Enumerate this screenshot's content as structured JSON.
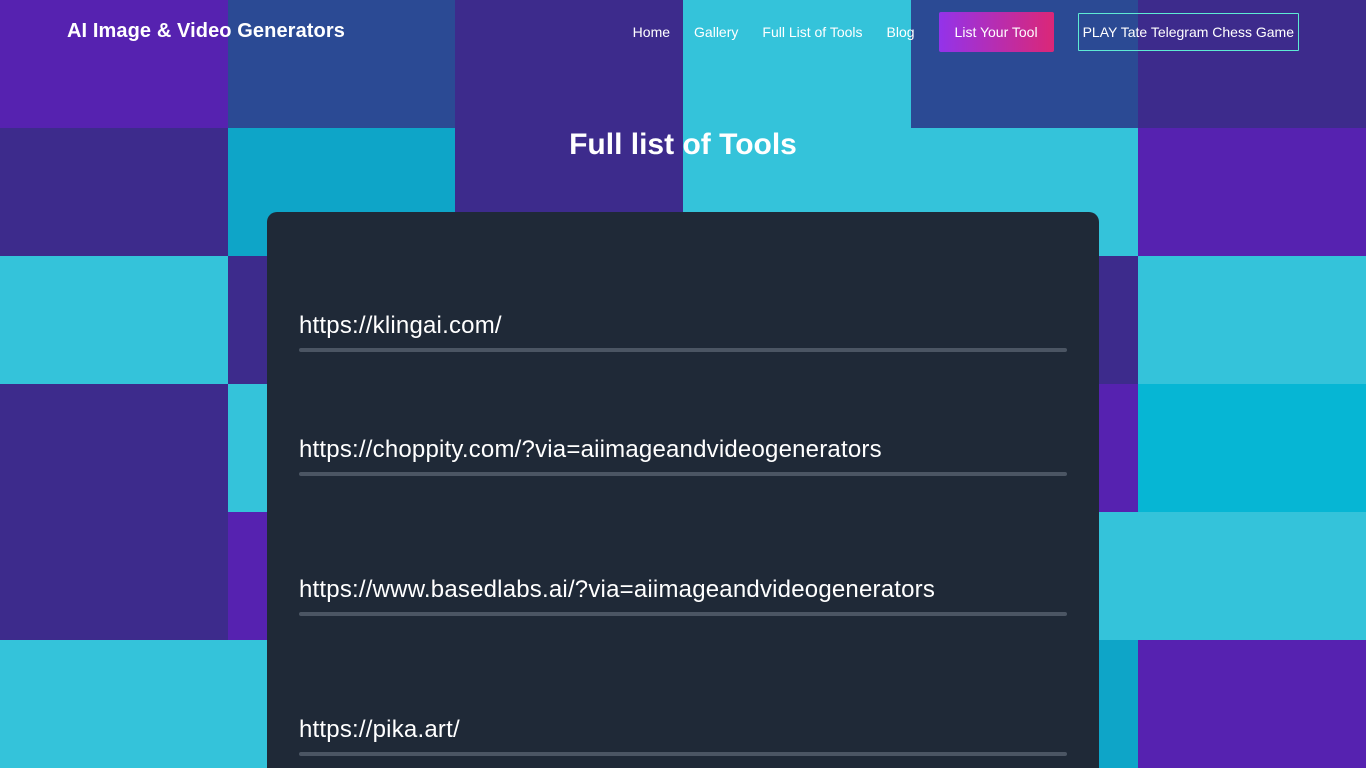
{
  "site": {
    "title": "AI Image & Video Generators"
  },
  "nav": {
    "items": [
      {
        "label": "Home"
      },
      {
        "label": "Gallery"
      },
      {
        "label": "Full List of Tools"
      },
      {
        "label": "Blog"
      }
    ],
    "cta_label": "List Your Tool",
    "outline_label": "PLAY Tate Telegram Chess Game"
  },
  "main": {
    "heading": "Full list of Tools",
    "tools": [
      {
        "url": "https://klingai.com/"
      },
      {
        "url": "https://choppity.com/?via=aiimageandvideogenerators"
      },
      {
        "url": "https://www.basedlabs.ai/?via=aiimageandvideogenerators"
      },
      {
        "url": "https://pika.art/"
      }
    ]
  },
  "colors": {
    "card_background": "#1f2937",
    "divider": "#4b5563",
    "cta_gradient_start": "#9333ea",
    "cta_gradient_end": "#db2777",
    "outline_border": "#5eead4",
    "bg_purple": "#5b21b6",
    "bg_indigo": "#3b2a8a",
    "bg_cyan": "#34c3da",
    "bg_blue": "#2b4a94"
  }
}
